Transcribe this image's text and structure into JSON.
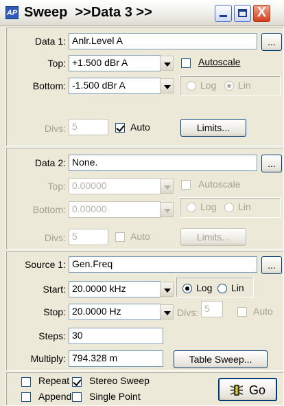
{
  "window": {
    "icon_text": "AP",
    "title": "Sweep  >>Data 3 >>",
    "minimize_label": "",
    "maximize_label": "",
    "close_label": "X"
  },
  "data1": {
    "label": "Data 1:",
    "value": "Anlr.Level A",
    "browse_label": "...",
    "top_label": "Top:",
    "top_value": "+1.500   dBr A",
    "autoscale_label": "Autoscale",
    "bottom_label": "Bottom:",
    "bottom_value": "-1.500   dBr A",
    "log_label": "Log",
    "lin_label": "Lin",
    "divs_label": "Divs:",
    "divs_value": "5",
    "auto_label": "Auto",
    "limits_label": "Limits..."
  },
  "data2": {
    "label": "Data 2:",
    "value": "None.",
    "browse_label": "...",
    "top_label": "Top:",
    "top_value": "0.00000",
    "autoscale_label": "Autoscale",
    "bottom_label": "Bottom:",
    "bottom_value": "0.00000",
    "log_label": "Log",
    "lin_label": "Lin",
    "divs_label": "Divs:",
    "divs_value": "5",
    "auto_label": "Auto",
    "limits_label": "Limits..."
  },
  "source1": {
    "label": "Source 1:",
    "value": "Gen.Freq",
    "browse_label": "...",
    "start_label": "Start:",
    "start_value": "20.0000 kHz",
    "log_label": "Log",
    "lin_label": "Lin",
    "stop_label": "Stop:",
    "stop_value": "20.0000  Hz",
    "divs_label": "Divs:",
    "divs_value": "5",
    "auto_label": "Auto",
    "steps_label": "Steps:",
    "steps_value": "30",
    "multiply_label": "Multiply:",
    "multiply_value": "794.328 m",
    "table_sweep_label": "Table Sweep..."
  },
  "options": {
    "repeat_label": "Repeat",
    "stereo_sweep_label": "Stereo Sweep",
    "append_label": "Append",
    "single_point_label": "Single Point",
    "go_label": "Go"
  }
}
